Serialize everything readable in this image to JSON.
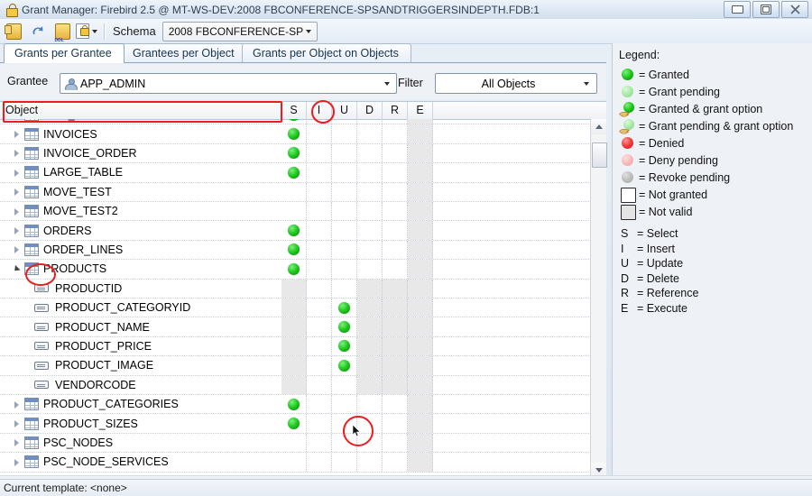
{
  "window": {
    "title": "Grant Manager: Firebird 2.5 @ MT-WS-DEV:2008 FBCONFERENCE-SPSANDTRIGGERSINDEPTH.FDB:1",
    "lock_icon": "lock-icon",
    "minimize": "–",
    "maximize": "□",
    "close": "✕"
  },
  "toolbar": {
    "buttons": [
      {
        "name": "commit-grants-button",
        "icon": "commit-icon",
        "label": ""
      },
      {
        "name": "undo-button",
        "icon": "undo-arrow-icon",
        "label": ""
      },
      {
        "name": "show-ddl-button",
        "icon": "ddl-icon",
        "label": "DDL"
      },
      {
        "name": "grant-options-button",
        "icon": "lock-dropdown-icon",
        "label": ""
      }
    ],
    "schema_label": "Schema",
    "schema_value": "2008 FBCONFERENCE-SP"
  },
  "tabs": [
    {
      "label": "Grants per Grantee",
      "selected": true
    },
    {
      "label": "Grantees per Object",
      "selected": false
    },
    {
      "label": "Grants per Object on Objects",
      "selected": false
    }
  ],
  "controls": {
    "grantee_label": "Grantee",
    "grantee_value": "APP_ADMIN",
    "grantee_icon": "user-icon",
    "filter_label": "Filter",
    "filter_value": "All Objects"
  },
  "grid": {
    "columns": [
      {
        "key": "object",
        "label": "Object"
      },
      {
        "key": "S",
        "label": "S"
      },
      {
        "key": "I",
        "label": "I"
      },
      {
        "key": "U",
        "label": "U"
      },
      {
        "key": "D",
        "label": "D"
      },
      {
        "key": "R",
        "label": "R"
      },
      {
        "key": "E",
        "label": "E"
      }
    ],
    "rows": [
      {
        "label": "GEO_BLOCKS",
        "type": "table",
        "expander": "closed",
        "perms": {
          "S": "granted",
          "I": "none",
          "U": "none",
          "D": "none",
          "R": "none",
          "E": "invalid"
        },
        "clipped": true
      },
      {
        "label": "INVOICES",
        "type": "table",
        "expander": "closed",
        "perms": {
          "S": "granted",
          "I": "none",
          "U": "none",
          "D": "none",
          "R": "none",
          "E": "invalid"
        }
      },
      {
        "label": "INVOICE_ORDER",
        "type": "table",
        "expander": "closed",
        "perms": {
          "S": "granted",
          "I": "none",
          "U": "none",
          "D": "none",
          "R": "none",
          "E": "invalid"
        }
      },
      {
        "label": "LARGE_TABLE",
        "type": "table",
        "expander": "closed",
        "perms": {
          "S": "granted",
          "I": "none",
          "U": "none",
          "D": "none",
          "R": "none",
          "E": "invalid"
        }
      },
      {
        "label": "MOVE_TEST",
        "type": "table",
        "expander": "closed",
        "perms": {
          "S": "none",
          "I": "none",
          "U": "none",
          "D": "none",
          "R": "none",
          "E": "invalid"
        }
      },
      {
        "label": "MOVE_TEST2",
        "type": "table",
        "expander": "closed",
        "perms": {
          "S": "none",
          "I": "none",
          "U": "none",
          "D": "none",
          "R": "none",
          "E": "invalid"
        }
      },
      {
        "label": "ORDERS",
        "type": "table",
        "expander": "closed",
        "perms": {
          "S": "granted",
          "I": "none",
          "U": "none",
          "D": "none",
          "R": "none",
          "E": "invalid"
        }
      },
      {
        "label": "ORDER_LINES",
        "type": "table",
        "expander": "closed",
        "perms": {
          "S": "granted",
          "I": "none",
          "U": "none",
          "D": "none",
          "R": "none",
          "E": "invalid"
        }
      },
      {
        "label": "PRODUCTS",
        "type": "table",
        "expander": "open",
        "perms": {
          "S": "granted",
          "I": "none",
          "U": "none",
          "D": "none",
          "R": "none",
          "E": "invalid"
        }
      },
      {
        "label": "PRODUCTID",
        "type": "column",
        "expander": "none",
        "perms": {
          "S": "invalid",
          "I": "none",
          "U": "none",
          "D": "invalid",
          "R": "invalid",
          "E": "invalid"
        }
      },
      {
        "label": "PRODUCT_CATEGORYID",
        "type": "column",
        "expander": "none",
        "perms": {
          "S": "invalid",
          "I": "none",
          "U": "granted",
          "D": "invalid",
          "R": "invalid",
          "E": "invalid"
        }
      },
      {
        "label": "PRODUCT_NAME",
        "type": "column",
        "expander": "none",
        "perms": {
          "S": "invalid",
          "I": "none",
          "U": "granted",
          "D": "invalid",
          "R": "invalid",
          "E": "invalid"
        }
      },
      {
        "label": "PRODUCT_PRICE",
        "type": "column",
        "expander": "none",
        "perms": {
          "S": "invalid",
          "I": "none",
          "U": "granted",
          "D": "invalid",
          "R": "invalid",
          "E": "invalid"
        }
      },
      {
        "label": "PRODUCT_IMAGE",
        "type": "column",
        "expander": "none",
        "perms": {
          "S": "invalid",
          "I": "none",
          "U": "granted",
          "D": "invalid",
          "R": "invalid",
          "E": "invalid"
        }
      },
      {
        "label": "VENDORCODE",
        "type": "column",
        "expander": "none",
        "perms": {
          "S": "invalid",
          "I": "none",
          "U": "none",
          "D": "invalid",
          "R": "invalid",
          "E": "invalid"
        }
      },
      {
        "label": "PRODUCT_CATEGORIES",
        "type": "table",
        "expander": "closed",
        "perms": {
          "S": "granted",
          "I": "none",
          "U": "none",
          "D": "none",
          "R": "none",
          "E": "invalid"
        }
      },
      {
        "label": "PRODUCT_SIZES",
        "type": "table",
        "expander": "closed",
        "perms": {
          "S": "granted",
          "I": "none",
          "U": "none",
          "D": "none",
          "R": "none",
          "E": "invalid"
        }
      },
      {
        "label": "PSC_NODES",
        "type": "table",
        "expander": "closed",
        "perms": {
          "S": "none",
          "I": "none",
          "U": "none",
          "D": "none",
          "R": "none",
          "E": "invalid"
        }
      },
      {
        "label": "PSC_NODE_SERVICES",
        "type": "table",
        "expander": "closed",
        "perms": {
          "S": "none",
          "I": "none",
          "U": "none",
          "D": "none",
          "R": "none",
          "E": "invalid"
        }
      }
    ]
  },
  "legend": {
    "title": "Legend:",
    "states": [
      {
        "symbol": "granted",
        "text": "= Granted"
      },
      {
        "symbol": "gpending",
        "text": "= Grant pending"
      },
      {
        "symbol": "granted-opt",
        "text": "= Granted & grant option"
      },
      {
        "symbol": "gpending-opt",
        "text": "= Grant pending & grant option"
      },
      {
        "symbol": "denied",
        "text": "= Denied"
      },
      {
        "symbol": "dpending",
        "text": "= Deny pending"
      },
      {
        "symbol": "rpending",
        "text": "= Revoke pending"
      },
      {
        "symbol": "box",
        "text": "= Not granted"
      },
      {
        "symbol": "boxgray",
        "text": "= Not valid"
      }
    ],
    "keys": [
      {
        "key": "S",
        "text": "= Select"
      },
      {
        "key": "I",
        "text": "= Insert"
      },
      {
        "key": "U",
        "text": "= Update"
      },
      {
        "key": "D",
        "text": "= Delete"
      },
      {
        "key": "R",
        "text": "= Reference"
      },
      {
        "key": "E",
        "text": "= Execute"
      }
    ]
  },
  "statusbar": {
    "text": "Current template: <none>"
  },
  "annotations": {
    "object_header_highlight": "Object column header outlined in red",
    "insert_column_highlight": "I column header circled in red",
    "products_icon_highlight": "PRODUCTS table icon circled in red",
    "cursor_cell_highlight": "PRODUCT_SIZES Update cell circled in red with mouse cursor"
  },
  "colors": {
    "annotation": "#ee1c1c",
    "granted": "#1cc41c",
    "denied": "#f23b3b",
    "invalid_cell": "#e8e8e8"
  }
}
